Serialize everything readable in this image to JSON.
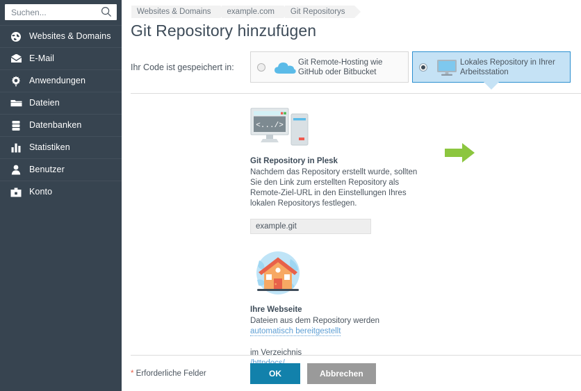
{
  "sidebar": {
    "search": {
      "placeholder": "Suchen...",
      "value": "",
      "icon": "search-icon"
    },
    "items": [
      {
        "label": "Websites & Domains",
        "icon": "globe-icon"
      },
      {
        "label": "E-Mail",
        "icon": "envelope-icon"
      },
      {
        "label": "Anwendungen",
        "icon": "gear-icon"
      },
      {
        "label": "Dateien",
        "icon": "folder-icon"
      },
      {
        "label": "Datenbanken",
        "icon": "database-icon"
      },
      {
        "label": "Statistiken",
        "icon": "bar-chart-icon"
      },
      {
        "label": "Benutzer",
        "icon": "user-icon"
      },
      {
        "label": "Konto",
        "icon": "briefcase-icon"
      }
    ]
  },
  "breadcrumb": [
    {
      "label": "Websites & Domains"
    },
    {
      "label": "example.com"
    },
    {
      "label": "Git Repositorys"
    }
  ],
  "page": {
    "title": "Git Repository hinzufügen"
  },
  "choice_section": {
    "label": "Ihr Code ist gespeichert in:",
    "options": [
      {
        "label": "Git Remote-Hosting wie GitHub oder Bitbucket",
        "icon": "cloud-icon",
        "selected": false
      },
      {
        "label": "Lokales Repository in Ihrer Arbeitsstation",
        "icon": "desktop-monitor-icon",
        "selected": true
      }
    ]
  },
  "plesk_block": {
    "illustration": "desktop-code-window-icon",
    "heading": "Git Repository in Plesk",
    "description": "Nachdem das Repository erstellt wurde, sollten Sie den Link zum erstellten Repository als Remote-Ziel-URL in den Einstellungen Ihres lokalen Repositorys festlegen.",
    "repo_field_value": "example.git"
  },
  "website_block": {
    "illustration": "globe-house-icon",
    "heading": "Ihre Webseite",
    "text_before_link": "Dateien aus dem Repository werden",
    "link_label": "automatisch bereitgestellt",
    "text_directory": "im Verzeichnis",
    "directory_link": "/httpdocs/",
    "directory_suffix": "."
  },
  "arrow": {
    "icon": "green-right-arrow-icon",
    "color": "#8cc63f"
  },
  "footer": {
    "required_star": "*",
    "required_note": " Erforderliche Felder",
    "ok_label": "OK",
    "cancel_label": "Abbrechen"
  },
  "colors": {
    "sidebar_bg": "#374450",
    "accent_blue": "#1281ab",
    "selected_option_bg": "#c5e2f5",
    "selected_option_border": "#2b8fd0",
    "link_blue": "#5e9fd4",
    "green": "#8cc63f",
    "cancel_gray": "#9a9a9a"
  }
}
